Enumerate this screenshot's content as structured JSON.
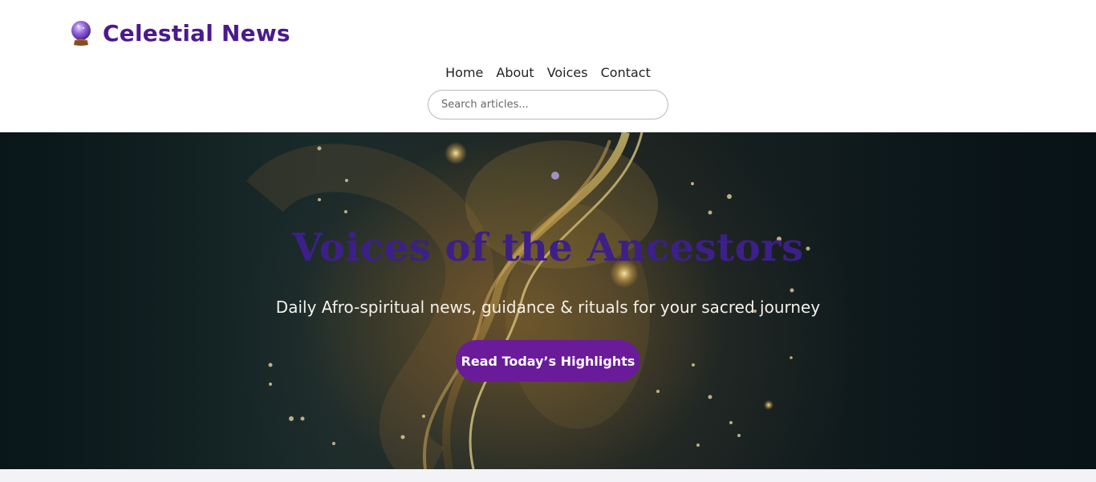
{
  "site": {
    "name": "Celestial News",
    "logo_icon": "crystal-ball-icon"
  },
  "nav": {
    "items": [
      "Home",
      "About",
      "Voices",
      "Contact"
    ]
  },
  "search": {
    "placeholder": "Search articles..."
  },
  "hero": {
    "title": "Voices of the Ancestors",
    "subtitle": "Daily Afro-spiritual news, guidance & rituals for your sacred journey",
    "cta_label": "Read Today’s Highlights"
  },
  "colors": {
    "brand": "#4a1a8c",
    "cta": "#6a1b9a",
    "hero_title": "#3d1f88"
  }
}
